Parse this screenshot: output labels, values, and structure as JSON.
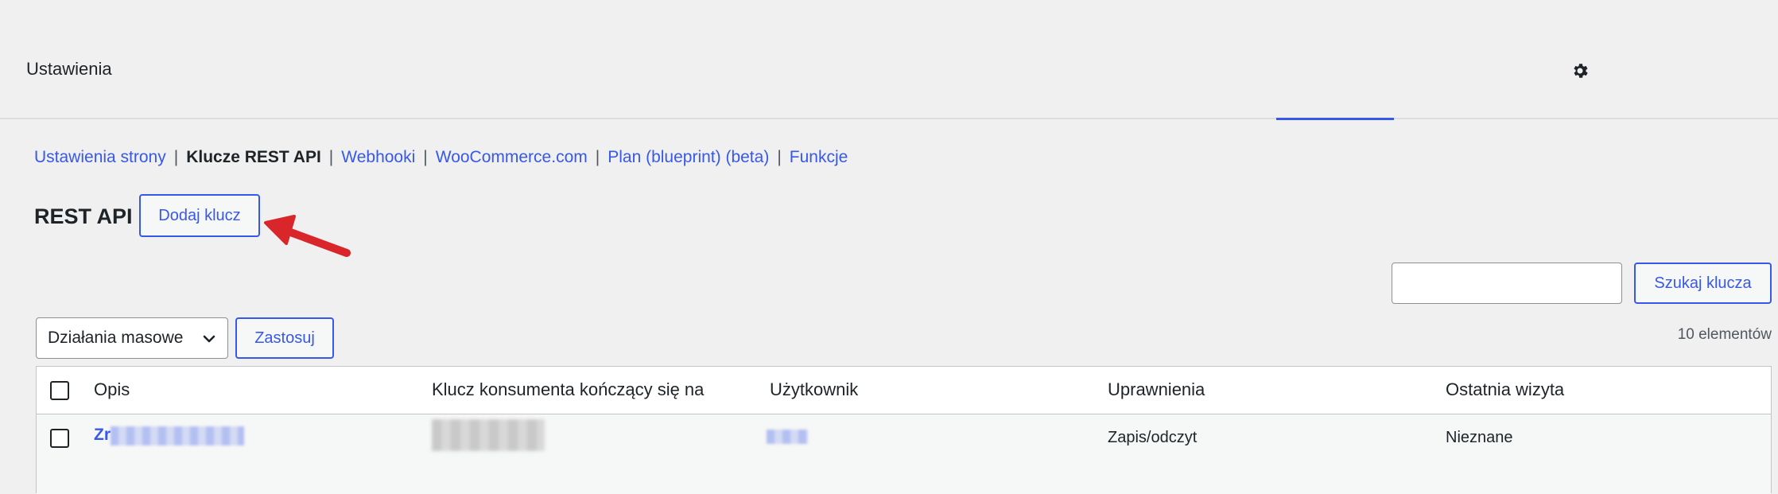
{
  "header": {
    "title": "Ustawienia",
    "settings_icon": "gear-icon"
  },
  "subnav": {
    "items": [
      {
        "label": "Ustawienia strony",
        "current": false
      },
      {
        "label": "Klucze REST API",
        "current": true
      },
      {
        "label": "Webhooki",
        "current": false
      },
      {
        "label": "WooCommerce.com",
        "current": false
      },
      {
        "label": "Plan (blueprint) (beta)",
        "current": false
      },
      {
        "label": "Funkcje",
        "current": false
      }
    ],
    "separator": "|"
  },
  "section": {
    "title": "REST API",
    "add_key_label": "Dodaj klucz"
  },
  "search": {
    "value": "",
    "button_label": "Szukaj klucza"
  },
  "bulk": {
    "selected": "Działania masowe",
    "apply_label": "Zastosuj"
  },
  "items_count": "10 elementów",
  "table": {
    "columns": [
      "Opis",
      "Klucz konsumenta kończący się na",
      "Użytkownik",
      "Uprawnienia",
      "Ostatnia wizyta"
    ],
    "rows": [
      {
        "description": "Zr",
        "consumer_key": "",
        "user": "",
        "permissions": "Zapis/odczyt",
        "last_access": "Nieznane"
      }
    ]
  },
  "colors": {
    "accent": "#3858e9",
    "annotation_arrow": "#d9262b",
    "background": "#f0f0f1"
  }
}
